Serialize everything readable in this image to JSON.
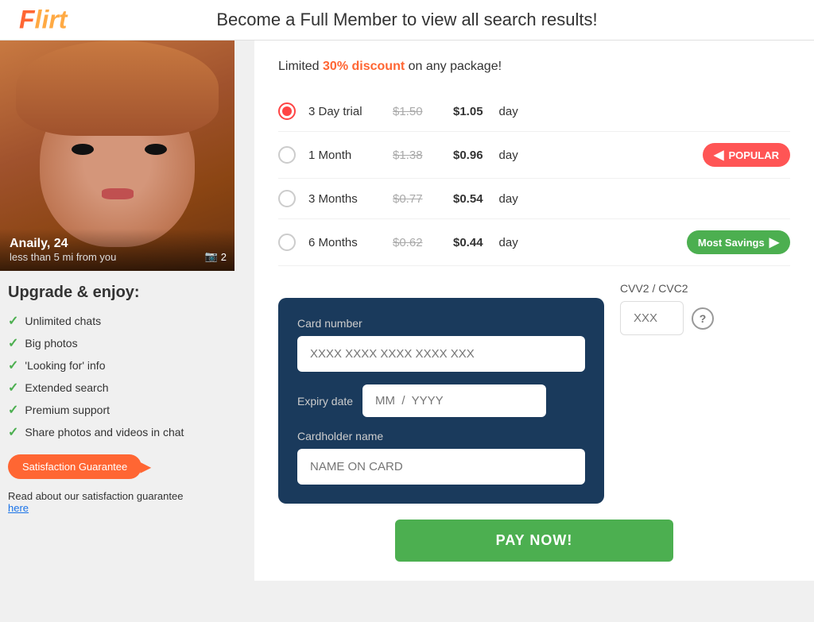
{
  "header": {
    "logo": "Flirt",
    "title": "Become a Full Member to view all search results!"
  },
  "sidebar": {
    "profile": {
      "name": "Anaily, 24",
      "distance": "less than 5 mi from you",
      "photo_count": "2"
    },
    "upgrade_title": "Upgrade & enjoy:",
    "features": [
      "Unlimited chats",
      "Big photos",
      "'Looking for' info",
      "Extended search",
      "Premium support",
      "Share photos and videos in chat"
    ],
    "satisfaction_btn": "Satisfaction Guarantee",
    "guarantee_text": "Read about our satisfaction guarantee",
    "guarantee_link": "here"
  },
  "plans": {
    "discount_text_pre": "Limited ",
    "discount_highlight": "30% discount",
    "discount_text_post": " on any package!",
    "items": [
      {
        "id": "3day",
        "label": "3 Day trial",
        "original": "$1.50",
        "price": "$1.05",
        "unit": "day",
        "selected": true,
        "badge": null
      },
      {
        "id": "1month",
        "label": "1 Month",
        "original": "$1.38",
        "price": "$0.96",
        "unit": "day",
        "selected": false,
        "badge": "popular"
      },
      {
        "id": "3months",
        "label": "3 Months",
        "original": "$0.77",
        "price": "$0.54",
        "unit": "day",
        "selected": false,
        "badge": null
      },
      {
        "id": "6months",
        "label": "6 Months",
        "original": "$0.62",
        "price": "$0.44",
        "unit": "day",
        "selected": false,
        "badge": "savings"
      }
    ],
    "popular_label": "POPULAR",
    "savings_label": "Most Savings"
  },
  "payment": {
    "card_label": "Card number",
    "card_placeholder": "XXXX XXXX XXXX XXXX XXX",
    "expiry_label": "Expiry date",
    "expiry_placeholder": "MM  /  YYYY",
    "cardholder_label": "Cardholder name",
    "cardholder_placeholder": "NAME ON CARD",
    "cvv_label": "CVV2 / CVC2",
    "cvv_placeholder": "XXX",
    "pay_btn": "PAY NOW!"
  }
}
